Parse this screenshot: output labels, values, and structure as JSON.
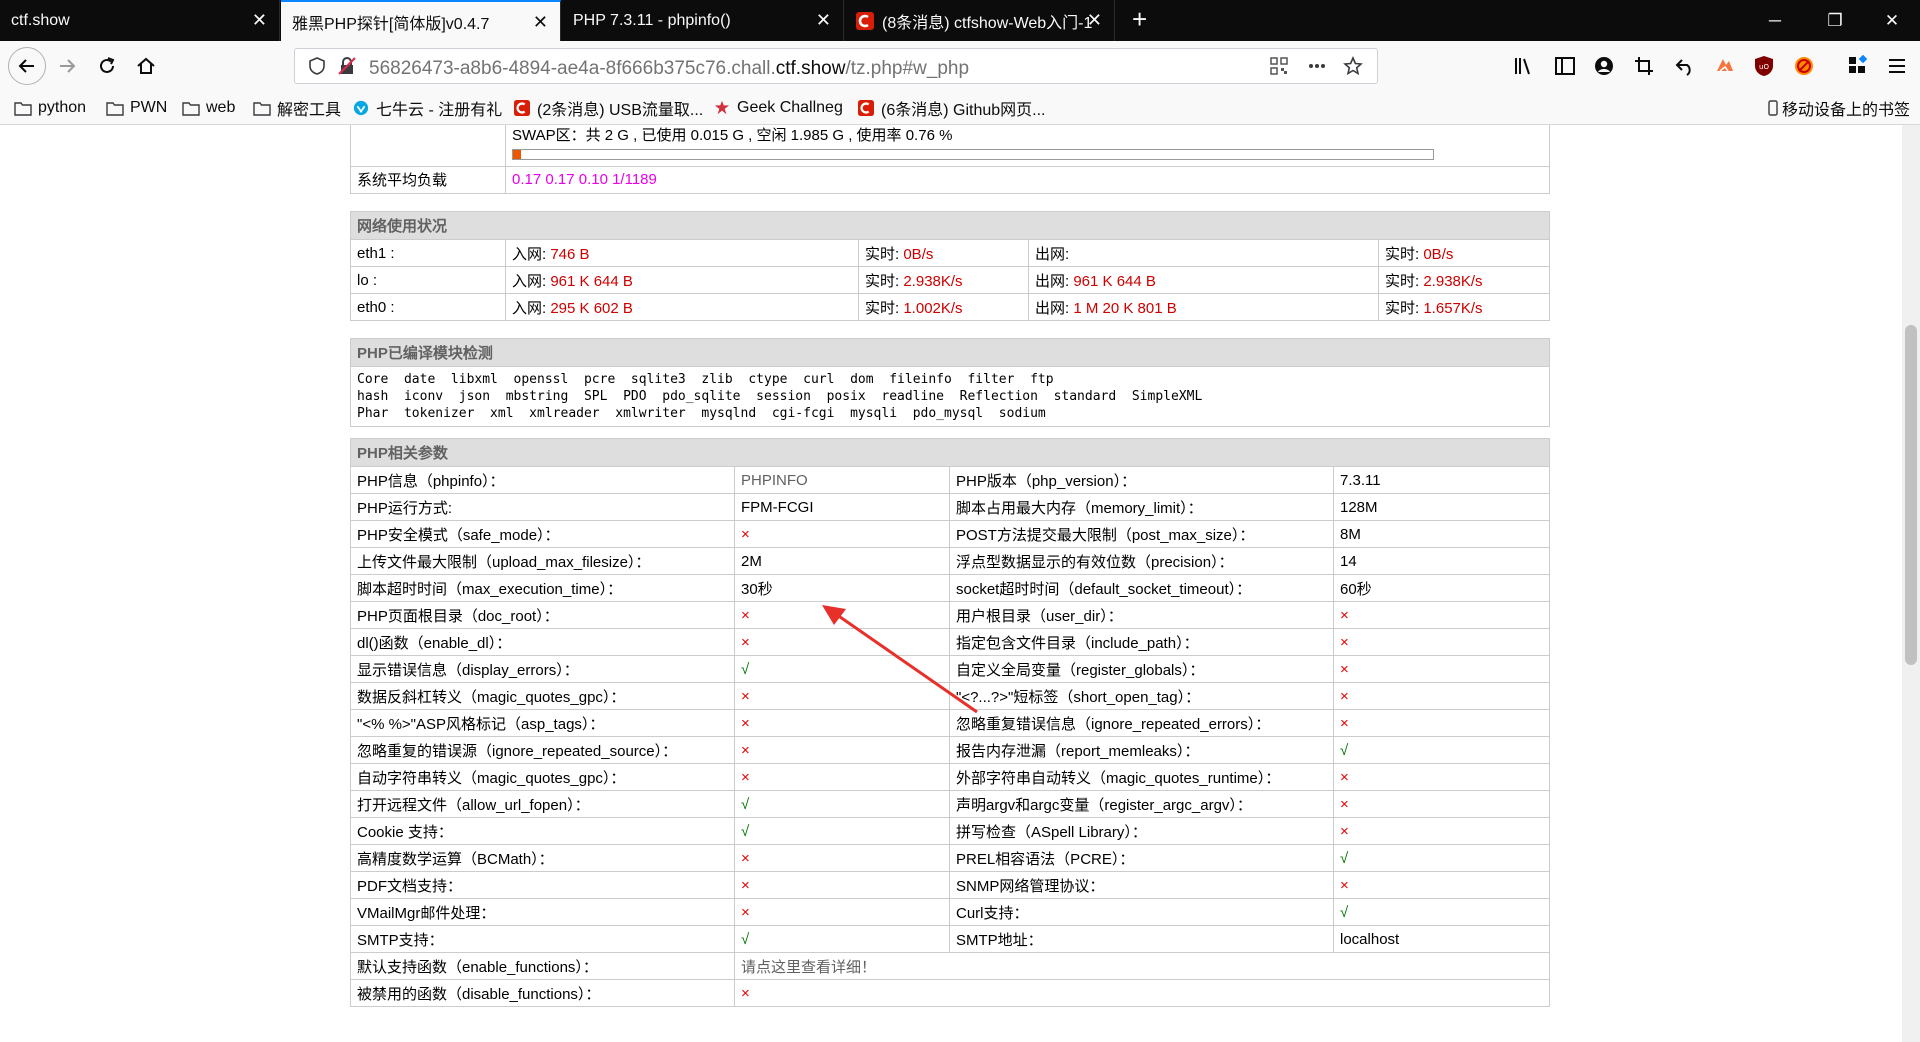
{
  "tabs": [
    {
      "title": "ctf.show",
      "active": false
    },
    {
      "title": "雅黑PHP探针[简体版]v0.4.7",
      "active": true
    },
    {
      "title": "PHP 7.3.11 - phpinfo()",
      "active": false
    },
    {
      "title": "(8条消息) ctfshow-Web入门-1",
      "active": false
    }
  ],
  "url": {
    "prefix": "56826473-a8b6-4894-ae4a-8f666b375c76.chall.",
    "host": "ctf.show",
    "suffix": "/tz.php#w_php"
  },
  "bookmarks": [
    {
      "label": "python",
      "icon": "folder-icon"
    },
    {
      "label": "PWN",
      "icon": "folder-icon"
    },
    {
      "label": "web",
      "icon": "folder-icon"
    },
    {
      "label": "解密工具",
      "icon": "folder-icon"
    },
    {
      "label": "七牛云 - 注册有礼",
      "icon": "qiniu-icon"
    },
    {
      "label": "(2条消息) USB流量取...",
      "icon": "csdn-icon"
    },
    {
      "label": "Geek Challneg",
      "icon": "geek-icon"
    },
    {
      "label": "(6条消息) Github网页...",
      "icon": "csdn-icon"
    },
    {
      "label": "移动设备上的书签",
      "icon": "mobile-icon"
    }
  ],
  "memory": {
    "swap_text": "SWAP区：共 2 G , 已使用 0.015 G , 空闲 1.985 G , 使用率 0.76 %",
    "swap_usage_percent": 0.76,
    "load_label": "系统平均负载",
    "load_value": "0.17 0.17 0.10 1/1189"
  },
  "network": {
    "title": "网络使用状况",
    "in_label": "入网:",
    "out_label": "出网:",
    "rt_label": "实时:",
    "rows": [
      {
        "iface": "eth1 :",
        "in": "746 B",
        "in_rt": "0B/s",
        "out": "",
        "out_rt": "0B/s"
      },
      {
        "iface": "lo :",
        "in": "961 K 644 B",
        "in_rt": "2.938K/s",
        "out": "961 K 644 B",
        "out_rt": "2.938K/s"
      },
      {
        "iface": "eth0 :",
        "in": "295 K 602 B",
        "in_rt": "1.002K/s",
        "out": "1 M 20 K 801 B",
        "out_rt": "1.657K/s"
      }
    ]
  },
  "modules": {
    "title": "PHP已编译模块检测",
    "lines": [
      "Core  date  libxml  openssl  pcre  sqlite3  zlib  ctype  curl  dom  fileinfo  filter  ftp",
      "hash  iconv  json  mbstring  SPL  PDO  pdo_sqlite  session  posix  readline  Reflection  standard  SimpleXML",
      "Phar  tokenizer  xml  xmlreader  xmlwriter  mysqlnd  cgi-fcgi  mysqli  pdo_mysql  sodium"
    ]
  },
  "php": {
    "title": "PHP相关参数",
    "rows": [
      {
        "k1": "PHP信息（phpinfo）：",
        "v1": "PHPINFO",
        "t1": "gray",
        "k2": "PHP版本（php_version）：",
        "v2": "7.3.11",
        "t2": "text"
      },
      {
        "k1": "PHP运行方式:",
        "v1": "FPM-FCGI",
        "t1": "text",
        "k2": "脚本占用最大内存（memory_limit）：",
        "v2": "128M",
        "t2": "text"
      },
      {
        "k1": "PHP安全模式（safe_mode）：",
        "v1": "×",
        "t1": "x",
        "k2": "POST方法提交最大限制（post_max_size）：",
        "v2": "8M",
        "t2": "text"
      },
      {
        "k1": "上传文件最大限制（upload_max_filesize）：",
        "v1": "2M",
        "t1": "text",
        "k2": "浮点型数据显示的有效位数（precision）：",
        "v2": "14",
        "t2": "text"
      },
      {
        "k1": "脚本超时时间（max_execution_time）：",
        "v1": "30秒",
        "t1": "text",
        "k2": "socket超时时间（default_socket_timeout）：",
        "v2": "60秒",
        "t2": "text"
      },
      {
        "k1": "PHP页面根目录（doc_root）：",
        "v1": "×",
        "t1": "x",
        "k2": "用户根目录（user_dir）：",
        "v2": "×",
        "t2": "x"
      },
      {
        "k1": "dl()函数（enable_dl）：",
        "v1": "×",
        "t1": "x",
        "k2": "指定包含文件目录（include_path）：",
        "v2": "×",
        "t2": "x"
      },
      {
        "k1": "显示错误信息（display_errors）：",
        "v1": "√",
        "t1": "ok",
        "k2": "自定义全局变量（register_globals）：",
        "v2": "×",
        "t2": "x"
      },
      {
        "k1": "数据反斜杠转义（magic_quotes_gpc）：",
        "v1": "×",
        "t1": "x",
        "k2": "\"<?...?>\"短标签（short_open_tag）：",
        "v2": "×",
        "t2": "x"
      },
      {
        "k1": "\"<% %>\"ASP风格标记（asp_tags）：",
        "v1": "×",
        "t1": "x",
        "k2": "忽略重复错误信息（ignore_repeated_errors）：",
        "v2": "×",
        "t2": "x"
      },
      {
        "k1": "忽略重复的错误源（ignore_repeated_source）：",
        "v1": "×",
        "t1": "x",
        "k2": "报告内存泄漏（report_memleaks）：",
        "v2": "√",
        "t2": "ok"
      },
      {
        "k1": "自动字符串转义（magic_quotes_gpc）：",
        "v1": "×",
        "t1": "x",
        "k2": "外部字符串自动转义（magic_quotes_runtime）：",
        "v2": "×",
        "t2": "x"
      },
      {
        "k1": "打开远程文件（allow_url_fopen）：",
        "v1": "√",
        "t1": "ok",
        "k2": "声明argv和argc变量（register_argc_argv）：",
        "v2": "×",
        "t2": "x"
      },
      {
        "k1": "Cookie 支持：",
        "v1": "√",
        "t1": "ok",
        "k2": "拼写检查（ASpell Library）：",
        "v2": "×",
        "t2": "x"
      },
      {
        "k1": "高精度数学运算（BCMath）：",
        "v1": "×",
        "t1": "x",
        "k2": "PREL相容语法（PCRE）：",
        "v2": "√",
        "t2": "ok"
      },
      {
        "k1": "PDF文档支持：",
        "v1": "×",
        "t1": "x",
        "k2": "SNMP网络管理协议：",
        "v2": "×",
        "t2": "x"
      },
      {
        "k1": "VMailMgr邮件处理：",
        "v1": "×",
        "t1": "x",
        "k2": "Curl支持：",
        "v2": "√",
        "t2": "ok"
      },
      {
        "k1": "SMTP支持：",
        "v1": "√",
        "t1": "ok",
        "k2": "SMTP地址：",
        "v2": "localhost",
        "t2": "text"
      }
    ],
    "enable_functions_label": "默认支持函数（enable_functions）：",
    "enable_functions_value": "请点这里查看详细！",
    "disable_functions_label": "被禁用的函数（disable_functions）：",
    "disable_functions_value": "×"
  },
  "colors": {
    "accent": "#0a84ff",
    "red_value": "#cc0000",
    "magenta": "#e800e8",
    "arrow": "#e8302a"
  }
}
